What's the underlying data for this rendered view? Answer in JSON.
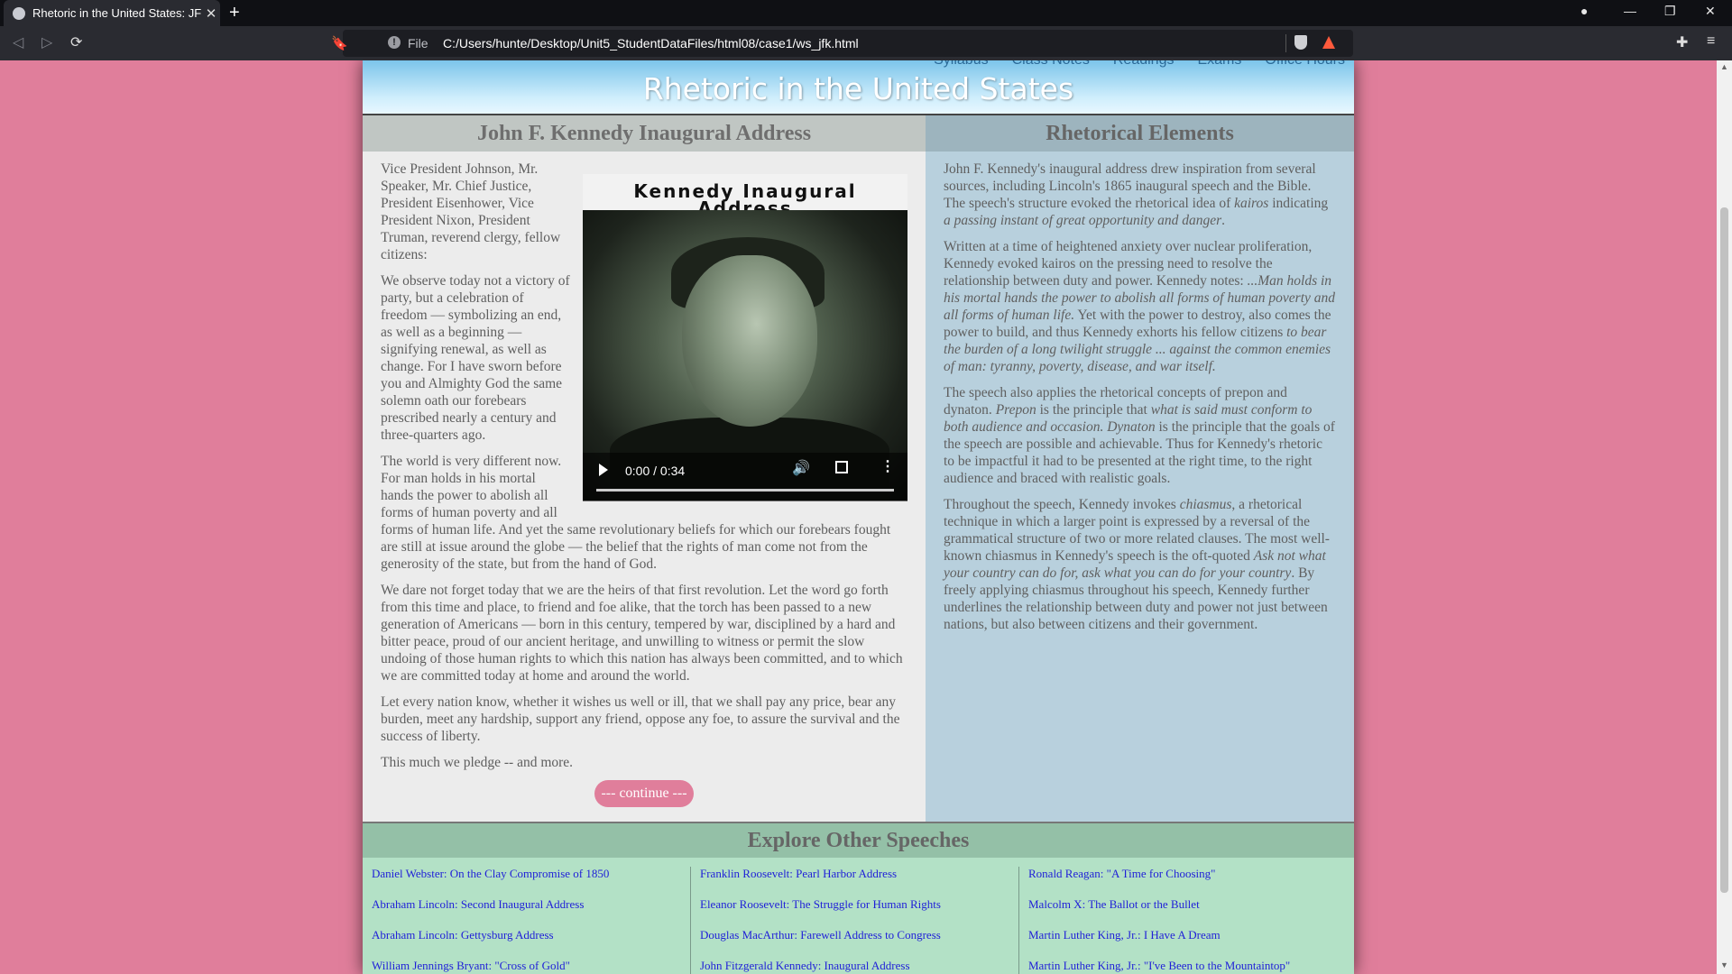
{
  "browser": {
    "tab_title": "Rhetoric in the United States: JFK",
    "new_tab": "+",
    "file_label": "File",
    "url": "C:/Users/hunte/Desktop/Unit5_StudentDataFiles/html08/case1/ws_jfk.html"
  },
  "site": {
    "nav": [
      "Syllabus",
      "Class Notes",
      "Readings",
      "Exams",
      "Office Hours"
    ],
    "title": "Rhetoric in the United States"
  },
  "article": {
    "heading": "John F. Kennedy Inaugural Address",
    "video_caption": "Kennedy Inaugural Address",
    "video_time": "0:00 / 0:34",
    "paragraphs": [
      "Vice President Johnson, Mr. Speaker, Mr. Chief Justice, President Eisenhower, Vice President Nixon, President Truman, reverend clergy, fellow citizens:",
      "We observe today not a victory of party, but a celebration of freedom — symbolizing an end, as well as a beginning — signifying renewal, as well as change. For I have sworn before you and Almighty God the same solemn oath our forebears prescribed nearly a century and three-quarters ago.",
      "The world is very different now. For man holds in his mortal hands the power to abolish all forms of human poverty and all forms of human life. And yet the same revolutionary beliefs for which our forebears fought are still at issue around the globe — the belief that the rights of man come not from the generosity of the state, but from the hand of God.",
      "We dare not forget today that we are the heirs of that first revolution. Let the word go forth from this time and place, to friend and foe alike, that the torch has been passed to a new generation of Americans — born in this century, tempered by war, disciplined by a hard and bitter peace, proud of our ancient heritage, and unwilling to witness or permit the slow undoing of those human rights to which this nation has always been committed, and to which we are committed today at home and around the world.",
      "Let every nation know, whether it wishes us well or ill, that we shall pay any price, bear any burden, meet any hardship, support any friend, oppose any foe, to assure the survival and the success of liberty.",
      "This much we pledge -- and more."
    ],
    "continue_label": "--- continue ---"
  },
  "aside": {
    "heading": "Rhetorical Elements",
    "p1": {
      "a": "John F. Kennedy's inaugural address drew inspiration from several sources, including Lincoln's 1865 inaugural speech and the Bible. The speech's structure evoked the rhetorical idea of ",
      "b": "kairos",
      "c": " indicating ",
      "d": "a passing instant of great opportunity and danger",
      "e": "."
    },
    "p2": {
      "a": "Written at a time of heightened anxiety over nuclear proliferation, Kennedy evoked kairos on the pressing need to resolve the relationship between duty and power. Kennedy notes: ",
      "b": "...Man holds in his mortal hands the power to abolish all forms of human poverty and all forms of human life.",
      "c": " Yet with the power to destroy, also comes the power to build, and thus Kennedy exhorts his fellow citizens ",
      "d": "to bear the burden of a long twilight struggle ... against the common enemies of man: tyranny, poverty, disease, and war itself."
    },
    "p3": {
      "a": "The speech also applies the rhetorical concepts of prepon and dynaton. ",
      "b": "Prepon",
      "c": " is the principle that ",
      "d": "what is said must conform to both audience and occasion.",
      "e": " ",
      "f": "Dynaton",
      "g": " is the principle that the goals of the speech are possible and achievable. Thus for Kennedy's rhetoric to be impactful it had to be presented at the right time, to the right audience and braced with realistic goals."
    },
    "p4": {
      "a": "Throughout the speech, Kennedy invokes ",
      "b": "chiasmus",
      "c": ", a rhetorical technique in which a larger point is expressed by a reversal of the grammatical structure of two or more related clauses. The most well-known chiasmus in Kennedy's speech is the oft-quoted ",
      "d": "Ask not what your country can do for, ask what you can do for your country",
      "e": ". By freely applying chiasmus throughout his speech, Kennedy further underlines the relationship between duty and power not just between nations, but also between citizens and their government."
    }
  },
  "explore": {
    "heading": "Explore Other Speeches",
    "columns": [
      [
        "Daniel Webster: On the Clay Compromise of 1850",
        "Abraham Lincoln: Second Inaugural Address",
        "Abraham Lincoln: Gettysburg Address",
        "William Jennings Bryant: \"Cross of Gold\""
      ],
      [
        "Franklin Roosevelt: Pearl Harbor Address",
        "Eleanor Roosevelt: The Struggle for Human Rights",
        "Douglas MacArthur: Farewell Address to Congress",
        "John Fitzgerald Kennedy: Inaugural Address"
      ],
      [
        "Ronald Reagan: \"A Time for Choosing\"",
        "Malcolm X: The Ballot or the Bullet",
        "Martin Luther King, Jr.: I Have A Dream",
        "Martin Luther King, Jr.: \"I've Been to the Mountaintop\""
      ]
    ]
  },
  "colors": {
    "page_background": "#e07e9b",
    "article_bg": "#ececec",
    "aside_bg": "#b8d0dd",
    "explore_bg": "#b3e1c6",
    "link": "#1f1fd8"
  }
}
